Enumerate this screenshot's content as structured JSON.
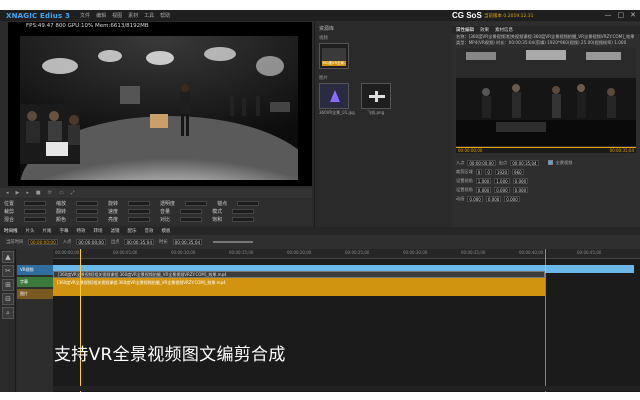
{
  "app": {
    "logo": "XNAGIC Edius 3",
    "menu": [
      "文件",
      "编辑",
      "视图",
      "素材",
      "工具",
      "帮助"
    ],
    "window_controls": [
      "—",
      "□",
      "✕"
    ],
    "brand": "CG SoS",
    "brand_sub": "当前版本 0.2019.12.31"
  },
  "player": {
    "stats": "FPS:49.47   800   GPU:10%  Mem:6613/8192MB",
    "controls": [
      "◂",
      "▶",
      "▸",
      "■",
      "⟳",
      "▭",
      "⤢"
    ],
    "prop_rows": [
      [
        "位置",
        "缩放",
        "旋转",
        "透明度",
        "锚点"
      ],
      [
        "裁剪",
        "翻转",
        "速度",
        "音量",
        "模式"
      ],
      [
        "混合",
        "颜色",
        "亮度",
        "对比",
        "饱和"
      ]
    ]
  },
  "library": {
    "title": "资源库",
    "section1": "视频",
    "item1_caption": "360度VR全景...",
    "section2": "图片",
    "items": [
      {
        "caption": "360VR全景_01.jpg"
      },
      {
        "caption": "飞机.png"
      }
    ]
  },
  "right_panel": {
    "tabs": [
      "属性编辑",
      "效果",
      "素材信息"
    ],
    "info_line1": "名称：[360度VR全景视频]相关视频课程:360度VR全景视频拍摄_VR全景视频VRZY.COM]_效果.mp4  (素材时长)",
    "info_line2": "类型：MP4(VR视频)  时长：00:00:35:04(剪辑)  1920*960(视频)  25.00(视频帧率)  1.000",
    "rows": [
      {
        "label": "入点",
        "v1": "00:00:00;00",
        "label2": "出点",
        "v2": "00:00:35;04"
      },
      {
        "label": "裁剪区域",
        "v1": "0",
        "label2": "0",
        "v2": "1920",
        "v3": "960"
      },
      {
        "label": "设置视角",
        "v1": "1.000",
        "label2": "",
        "v2": "1.000",
        "v3": "0.000"
      },
      {
        "label": "设置视角",
        "v1": "0.000",
        "label2": "",
        "v2": "0.000",
        "v3": "0.000"
      },
      {
        "label": "动画",
        "v1": "0.000",
        "label2": "",
        "v2": "0.000",
        "v3": "0.000"
      }
    ],
    "checkbox_label": "全景视频",
    "timecode": "00:00:00;00",
    "end_timecode": "00:00:35;04"
  },
  "timeline": {
    "tabs": [
      "时间线",
      "片头",
      "片尾",
      "字幕",
      "特效",
      "转场",
      "滤镜",
      "配乐",
      "音效",
      "模板"
    ],
    "tool_labels": [
      "当前时间",
      "00:00:00;00",
      "入点",
      "00:00:00;00",
      "出点",
      "00:00:35;04",
      "时长",
      "00:00:35;04"
    ],
    "track_names": [
      "VR视频",
      "字幕",
      "图片"
    ],
    "ruler_ticks": [
      "00:00:00;00",
      "00:00:05;00",
      "00:00:10;00",
      "00:00:15;00",
      "00:00:20;00",
      "00:00:25;00",
      "00:00:30;00",
      "00:00:35;00",
      "00:00:40;00",
      "00:00:45;00"
    ],
    "clip_video": "[360度VR全景视频]相关视频课程:360度VR全景视频拍摄_VR全景视频VRZY.COM]_效果.mp4",
    "clip_gold": "[360度VR全景视频]相关视频课程:360度VR全景视频拍摄_VR全景视频VRZY.COM]_效果.mp4",
    "tools": [
      "▲",
      "✂",
      "⊞",
      "⊟",
      "⌕"
    ]
  },
  "caption": "支持VR全景视频图文编剪合成",
  "colors": {
    "accent": "#3fa9f5",
    "gold": "#d19410",
    "timeline_blue": "#6bb8e8",
    "playhead": "#ffcc33"
  }
}
